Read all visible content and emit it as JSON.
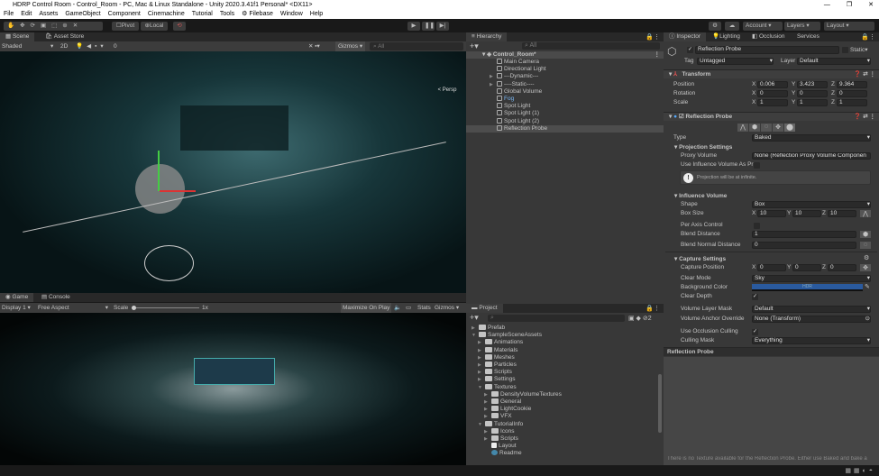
{
  "window": {
    "title": "HDRP Control Room - Control_Room - PC, Mac & Linux Standalone - Unity 2020.3.41f1 Personal* <DX11>"
  },
  "menu": [
    "File",
    "Edit",
    "Assets",
    "GameObject",
    "Component",
    "Cinemachine",
    "Tutorial",
    "Tools",
    "Filebase",
    "Window",
    "Help"
  ],
  "toolbar": {
    "pivot": "Pivot",
    "local": "Local",
    "account": "Account",
    "layers": "Layers",
    "layout": "Layout"
  },
  "scene": {
    "tabs": [
      "Scene",
      "Asset Store"
    ],
    "shading": "Shaded",
    "mode2d": "2D",
    "fx_count": "0",
    "gizmos": "Gizmos",
    "search_placeholder": "All",
    "persp": "< Persp"
  },
  "game": {
    "tabs": [
      "Game",
      "Console"
    ],
    "display": "Display 1",
    "aspect": "Free Aspect",
    "scale_label": "Scale",
    "scale_value": "1x",
    "maximize": "Maximize On Play",
    "stats": "Stats",
    "gizmos": "Gizmos"
  },
  "hierarchy": {
    "title": "Hierarchy",
    "search_placeholder": "All",
    "root": "Control_Room*",
    "items": [
      {
        "label": "Main Camera",
        "expandable": false
      },
      {
        "label": "Directional Light",
        "expandable": false
      },
      {
        "label": "---Dynamic---",
        "expandable": true
      },
      {
        "label": "----Static----",
        "expandable": true
      },
      {
        "label": "Global Volume",
        "expandable": false
      },
      {
        "label": "Fog",
        "expandable": false,
        "prefab": true
      },
      {
        "label": "Spot Light",
        "expandable": false
      },
      {
        "label": "Spot Light (1)",
        "expandable": false
      },
      {
        "label": "Spot Light (2)",
        "expandable": false
      },
      {
        "label": "Reflection Probe",
        "expandable": false,
        "selected": true
      }
    ]
  },
  "project": {
    "title": "Project",
    "hidden_count": "2",
    "items": [
      {
        "label": "Prefab",
        "depth": 0,
        "open": false,
        "type": "folder"
      },
      {
        "label": "SampleSceneAssets",
        "depth": 0,
        "open": true,
        "type": "folder"
      },
      {
        "label": "Animations",
        "depth": 1,
        "open": false,
        "type": "folder"
      },
      {
        "label": "Materials",
        "depth": 1,
        "open": false,
        "type": "folder"
      },
      {
        "label": "Meshes",
        "depth": 1,
        "open": false,
        "type": "folder"
      },
      {
        "label": "Particles",
        "depth": 1,
        "open": false,
        "type": "folder"
      },
      {
        "label": "Scripts",
        "depth": 1,
        "open": false,
        "type": "folder"
      },
      {
        "label": "Settings",
        "depth": 1,
        "open": false,
        "type": "folder"
      },
      {
        "label": "Textures",
        "depth": 1,
        "open": true,
        "type": "folder"
      },
      {
        "label": "DensityVolumeTextures",
        "depth": 2,
        "open": false,
        "type": "folder"
      },
      {
        "label": "General",
        "depth": 2,
        "open": false,
        "type": "folder"
      },
      {
        "label": "LightCookie",
        "depth": 2,
        "open": false,
        "type": "folder"
      },
      {
        "label": "VFX",
        "depth": 2,
        "open": false,
        "type": "folder"
      },
      {
        "label": "TutorialInfo",
        "depth": 1,
        "open": true,
        "type": "folder"
      },
      {
        "label": "Icons",
        "depth": 2,
        "open": false,
        "type": "folder"
      },
      {
        "label": "Scripts",
        "depth": 2,
        "open": false,
        "type": "folder"
      },
      {
        "label": "Layout",
        "depth": 2,
        "type": "file"
      },
      {
        "label": "Readme",
        "depth": 2,
        "type": "asset"
      }
    ]
  },
  "inspector": {
    "tabs": [
      "Inspector",
      "Lighting",
      "Occlusion",
      "Services"
    ],
    "object_name": "Reflection Probe",
    "static": "Static",
    "tag_label": "Tag",
    "tag": "Untagged",
    "layer_label": "Layer",
    "layer": "Default",
    "transform": {
      "title": "Transform",
      "position_label": "Position",
      "rotation_label": "Rotation",
      "scale_label": "Scale",
      "position": [
        "0.006",
        "3.423",
        "9.364"
      ],
      "rotation": [
        "0",
        "0",
        "0"
      ],
      "scale": [
        "1",
        "1",
        "1"
      ]
    },
    "probe": {
      "title": "Reflection Probe",
      "type_label": "Type",
      "type": "Baked",
      "projection_title": "Projection Settings",
      "proxy_label": "Proxy Volume",
      "proxy": "None (Reflection Proxy Volume Componen",
      "use_influence_label": "Use Influence Volume As Pr",
      "infinite_note": "Projection will be at infinite.",
      "influence_title": "Influence Volume",
      "shape_label": "Shape",
      "shape": "Box",
      "box_size_label": "Box Size",
      "box_size": [
        "10",
        "10",
        "10"
      ],
      "per_axis_label": "Per Axis Control",
      "blend_label": "Blend Distance",
      "blend": "1",
      "blend_normal_label": "Blend Normal Distance",
      "blend_normal": "0",
      "capture_title": "Capture Settings",
      "capture_pos_label": "Capture Position",
      "capture_pos": [
        "0",
        "0",
        "0"
      ],
      "clear_mode_label": "Clear Mode",
      "clear_mode": "Sky",
      "bg_color_label": "Background Color",
      "bg_color_text": "HDR",
      "bg_color": "#2a5a9e",
      "clear_depth_label": "Clear Depth",
      "layer_mask_label": "Volume Layer Mask",
      "layer_mask": "Default",
      "anchor_label": "Volume Anchor Override",
      "anchor": "None (Transform)",
      "occlusion_label": "Use Occlusion Culling",
      "culling_label": "Culling Mask",
      "culling": "Everything"
    },
    "preview_title": "Reflection Probe"
  },
  "status": {
    "message": "There is no Texture available for the Reflection Probe. Either use Baked and bake a"
  }
}
